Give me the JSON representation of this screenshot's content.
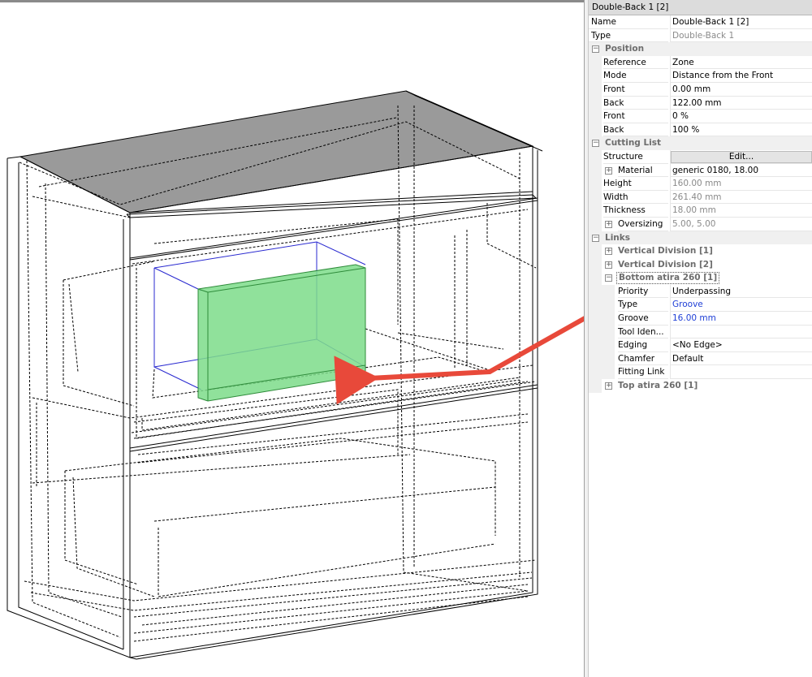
{
  "properties": {
    "header": "Double-Back 1 [2]",
    "name_label": "Name",
    "name_value": "Double-Back 1 [2]",
    "type_label": "Type",
    "type_value": "Double-Back 1",
    "position": {
      "category": "Position",
      "reference_label": "Reference",
      "reference_value": "Zone",
      "mode_label": "Mode",
      "mode_value": "Distance from the Front",
      "front_label": "Front",
      "front_value": "0.00 mm",
      "back_label": "Back",
      "back_value": "122.00 mm",
      "front_pct_label": "Front",
      "front_pct_value": "0 %",
      "back_pct_label": "Back",
      "back_pct_value": "100 %"
    },
    "cutting_list": {
      "category": "Cutting List",
      "structure_label": "Structure",
      "structure_button": "Edit...",
      "material_label": "Material",
      "material_value": "generic 0180, 18.00",
      "height_label": "Height",
      "height_value": "160.00 mm",
      "width_label": "Width",
      "width_value": "261.40 mm",
      "thickness_label": "Thickness",
      "thickness_value": "18.00 mm",
      "oversizing_label": "Oversizing",
      "oversizing_value": "5.00, 5.00"
    },
    "links": {
      "category": "Links",
      "vertical_division_1": "Vertical Division [1]",
      "vertical_division_2": "Vertical Division [2]",
      "bottom_link": "Bottom atira 260 [1]",
      "priority_label": "Priority",
      "priority_value": "Underpassing",
      "type_label": "Type",
      "type_value": "Groove",
      "groove_label": "Groove",
      "groove_value": "16.00 mm",
      "tool_label": "Tool Iden...",
      "tool_value": "",
      "edging_label": "Edging",
      "edging_value": "<No Edge>",
      "chamfer_label": "Chamfer",
      "chamfer_value": "Default",
      "fitting_label": "Fitting Link",
      "fitting_value": "",
      "top_link": "Top atira 260 [1]"
    }
  },
  "colors": {
    "highlight_panel": "#7ddc8a",
    "selection_outline": "#2a2ad0",
    "arrow": "#e8493a",
    "link_value_blue": "#1f3fd6"
  }
}
